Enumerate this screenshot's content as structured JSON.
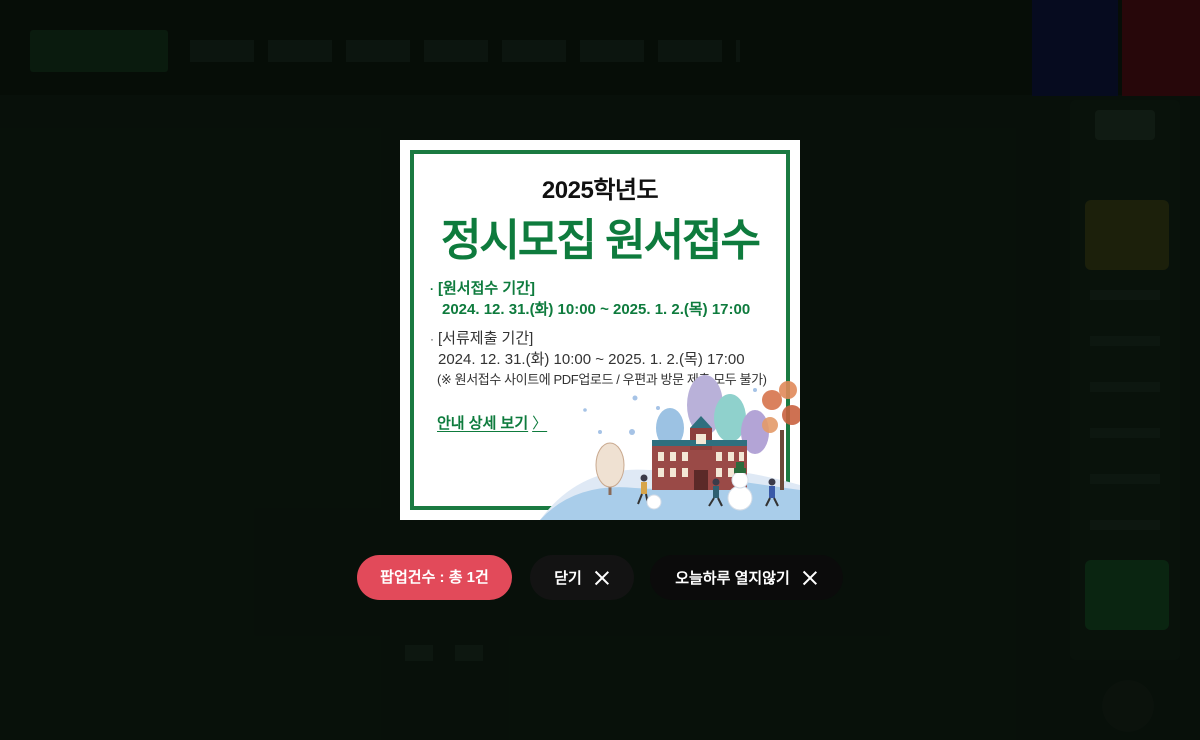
{
  "popup": {
    "year": "2025학년도",
    "title": "정시모집 원서접수",
    "application_label": "[원서접수 기간]",
    "application_period": "2024. 12. 31.(화) 10:00 ~ 2025. 1. 2.(목) 17:00",
    "document_label": "[서류제출 기간]",
    "document_period": "2024. 12. 31.(화) 10:00 ~ 2025. 1. 2.(목) 17:00",
    "document_note": "(※ 원서접수 사이트에 PDF업로드 / 우편과 방문 제출 모두 불가)",
    "detail_link": "안내 상세 보기",
    "bullet": "·",
    "arrow": "〉"
  },
  "controls": {
    "count_label": "팝업건수 : 총 1건",
    "close_label": "닫기",
    "today_label": "오늘하루 열지않기"
  },
  "colors": {
    "brand_green": "#0e7b3d",
    "count_badge": "#e24a5a",
    "button_dark": "#0b0b0b"
  }
}
